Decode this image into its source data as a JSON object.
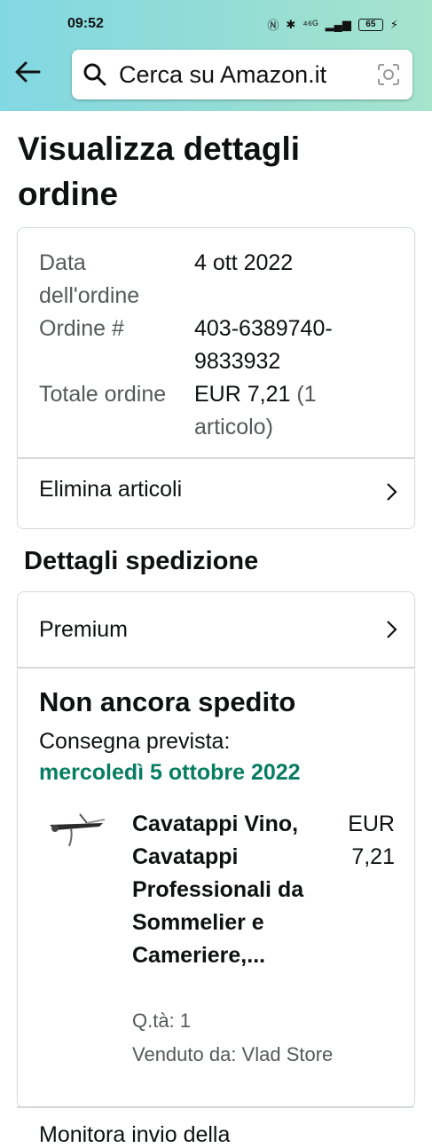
{
  "status": {
    "time": "09:52",
    "signal": "⁴⁶ᴳ",
    "battery": "65"
  },
  "search": {
    "placeholder": "Cerca su Amazon.it"
  },
  "page_title": "Visualizza dettagli ordine",
  "order": {
    "date_label": "Data dell'ordine",
    "date_value": "4 ott 2022",
    "number_label": "Ordine #",
    "number_value": "403-6389740-9833932",
    "total_label": "Totale ordine",
    "total_value": "EUR 7,21",
    "total_items": "(1 articolo)",
    "remove_items": "Elimina articoli"
  },
  "shipping": {
    "heading": "Dettagli spedizione",
    "service": "Premium",
    "status": "Non ancora spedito",
    "delivery_label": "Consegna prevista:",
    "delivery_date": "mercoledì 5 ottobre 2022",
    "item": {
      "title": "Cavatappi Vino, Cavatappi Professionali da Sommelier e Cameriere,...",
      "price": "EUR 7,21",
      "qty": "Q.tà: 1",
      "seller": "Venduto da: Vlad Store"
    }
  },
  "next_section": "Monitora invio della"
}
